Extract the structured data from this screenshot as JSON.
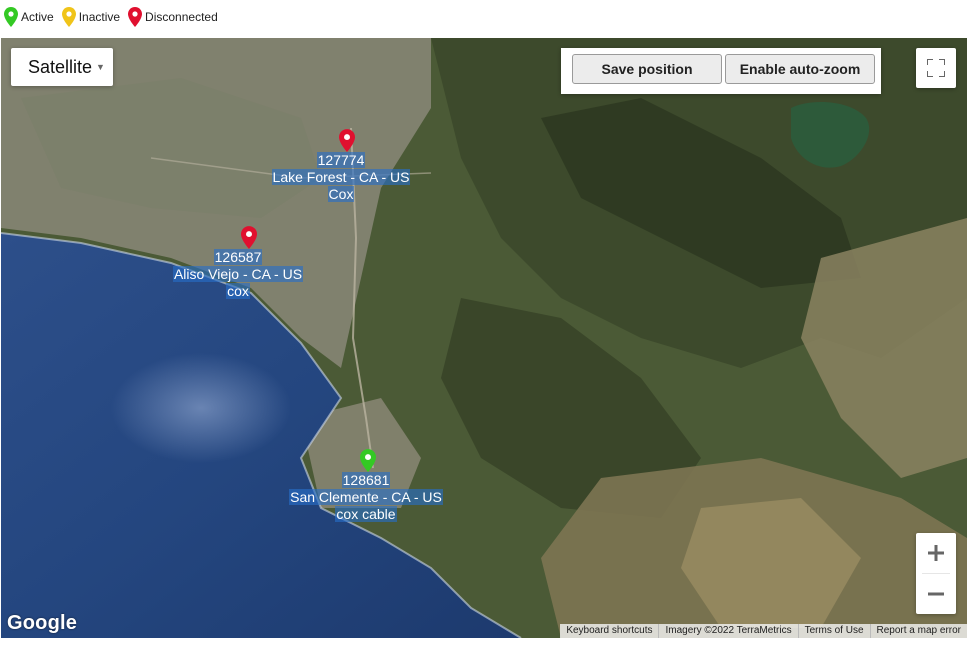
{
  "legend": [
    {
      "label": "Active",
      "color": "#34c924",
      "icon": "marker-icon"
    },
    {
      "label": "Inactive",
      "color": "#f0c419",
      "icon": "marker-icon"
    },
    {
      "label": "Disconnected",
      "color": "#e0102f",
      "icon": "marker-icon"
    }
  ],
  "map": {
    "type_selector": {
      "label": "Satellite",
      "icon": "caret-down-icon"
    },
    "save_position_label": "Save position",
    "auto_zoom_label": "Enable auto-zoom",
    "fullscreen_icon": "fullscreen-icon",
    "zoom_in_label": "+",
    "zoom_out_label": "−",
    "logo": "Google",
    "attribution": {
      "keyboard": "Keyboard shortcuts",
      "imagery": "Imagery ©2022 TerraMetrics",
      "terms": "Terms of Use",
      "report": "Report a map error"
    },
    "markers": [
      {
        "id": "127774",
        "location": "Lake Forest - CA - US",
        "isp": "Cox",
        "status": "Disconnected",
        "color": "#e0102f"
      },
      {
        "id": "126587",
        "location": "Aliso Viejo - CA - US",
        "isp": "cox",
        "status": "Disconnected",
        "color": "#e0102f"
      },
      {
        "id": "128681",
        "location": "San Clemente - CA - US",
        "isp": "cox cable",
        "status": "Active",
        "color": "#34c924"
      }
    ]
  }
}
